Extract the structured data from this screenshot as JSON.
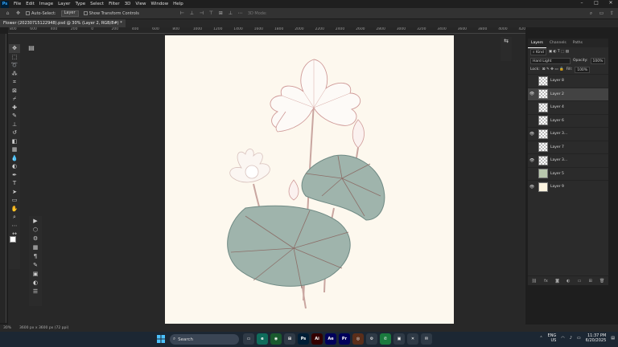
{
  "app": {
    "logo": "Ps",
    "menu": [
      "File",
      "Edit",
      "Image",
      "Layer",
      "Type",
      "Select",
      "Filter",
      "3D",
      "View",
      "Window",
      "Help"
    ],
    "window_controls": [
      "–",
      "□",
      "✕"
    ]
  },
  "options_bar": {
    "auto_select_label": "Auto-Select:",
    "auto_select_value": "Layer",
    "transform_label": "Show Transform Controls",
    "mode_3d_label": "3D Mode:"
  },
  "document": {
    "tab_title": "Flower (20230715122948).psd @ 30% (Layer 2, RGB/8#) *"
  },
  "ruler_labels": [
    "800",
    "600",
    "400",
    "200",
    "0",
    "200",
    "400",
    "600",
    "800",
    "1000",
    "1200",
    "1400",
    "1600",
    "1800",
    "2000",
    "2200",
    "2400",
    "2600",
    "2800",
    "3000",
    "3200",
    "3400",
    "3600",
    "3800",
    "4000",
    "4200",
    "4400"
  ],
  "layers_panel": {
    "tabs": [
      "Layers",
      "Channels",
      "Paths"
    ],
    "filter_label": "Kind",
    "blend_mode": "Hard Light",
    "opacity_label": "Opacity:",
    "opacity_value": "100%",
    "lock_label": "Lock:",
    "fill_label": "Fill:",
    "fill_value": "100%",
    "layers": [
      {
        "name": "Layer 8",
        "visible": false,
        "selected": false,
        "thumb": "checker"
      },
      {
        "name": "Layer 2",
        "visible": true,
        "selected": true,
        "thumb": "checker"
      },
      {
        "name": "Layer 4",
        "visible": false,
        "selected": false,
        "thumb": "checker"
      },
      {
        "name": "Layer 6",
        "visible": false,
        "selected": false,
        "thumb": "checker"
      },
      {
        "name": "Layer 3...",
        "visible": true,
        "selected": false,
        "thumb": "checker"
      },
      {
        "name": "Layer 7",
        "visible": false,
        "selected": false,
        "thumb": "checker"
      },
      {
        "name": "Layer 3...",
        "visible": true,
        "selected": false,
        "thumb": "checker"
      },
      {
        "name": "Layer 5",
        "visible": false,
        "selected": false,
        "thumb": "green"
      },
      {
        "name": "Layer 9",
        "visible": true,
        "selected": false,
        "thumb": "solid"
      }
    ]
  },
  "status": {
    "zoom": "30%",
    "dimensions": "3600 px x 3600 px (72 ppi)"
  },
  "taskbar": {
    "search_label": "Search",
    "apps": [
      {
        "name": "Ps",
        "color": "#001e36"
      },
      {
        "name": "Ai",
        "color": "#330000"
      },
      {
        "name": "Ae",
        "color": "#00005b"
      },
      {
        "name": "Pr",
        "color": "#00005b"
      }
    ],
    "lang_top": "ENG",
    "lang_bottom": "US",
    "time": "11:37 PM",
    "date": "6/20/2025"
  }
}
